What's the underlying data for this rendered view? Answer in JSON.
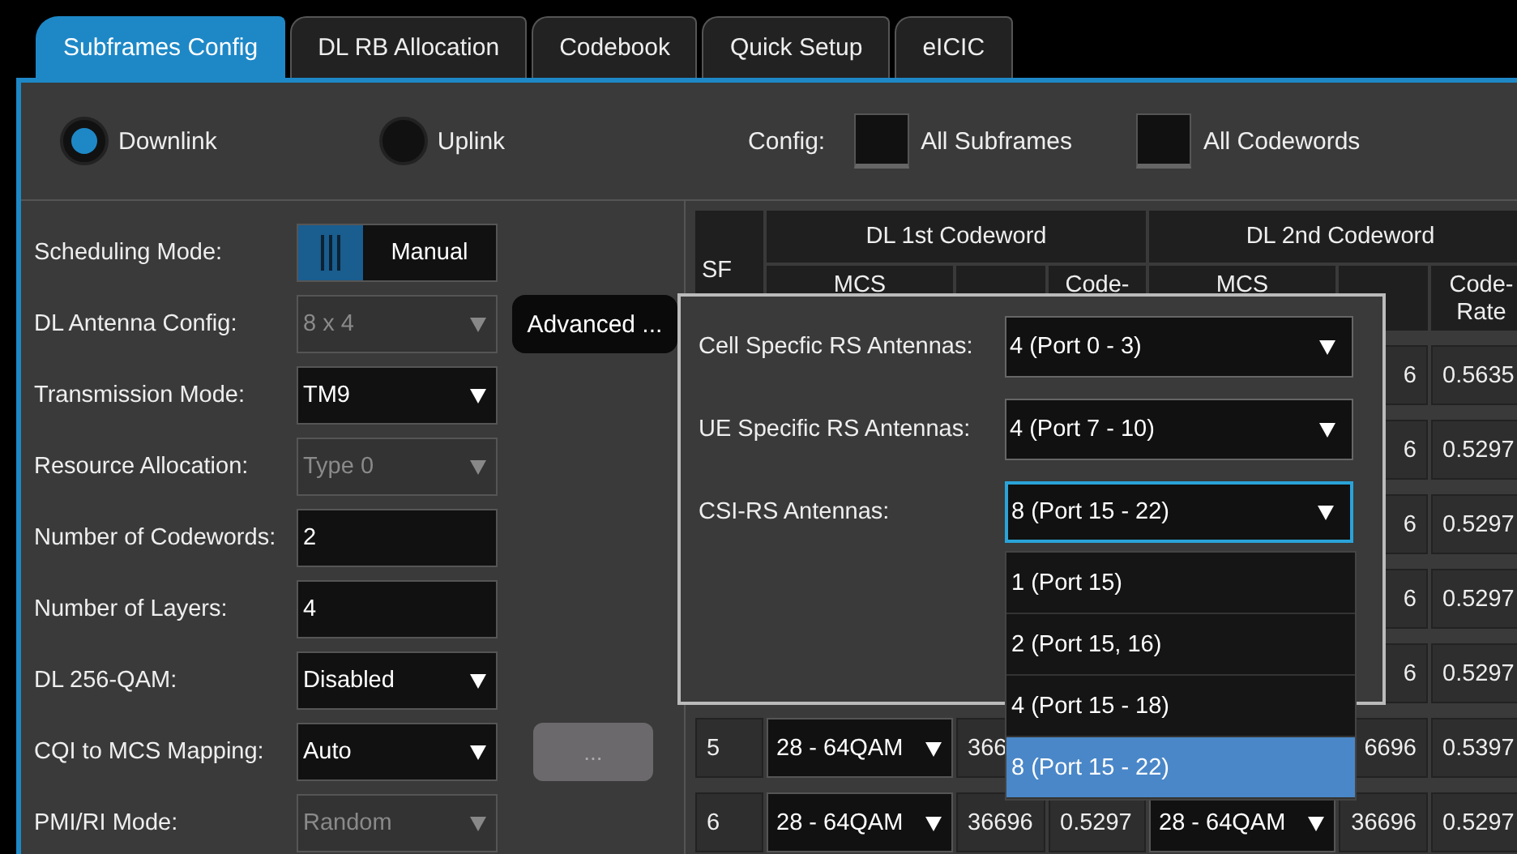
{
  "tabs": [
    {
      "label": "Subframes Config",
      "selected": true
    },
    {
      "label": "DL RB Allocation",
      "selected": false
    },
    {
      "label": "Codebook",
      "selected": false
    },
    {
      "label": "Quick Setup",
      "selected": false
    },
    {
      "label": "eICIC",
      "selected": false
    }
  ],
  "direction": [
    {
      "label": "Downlink",
      "selected": true
    },
    {
      "label": "Uplink",
      "selected": false
    }
  ],
  "config": {
    "label": "Config:",
    "options": [
      {
        "label": "All Subframes",
        "checked": false
      },
      {
        "label": "All Codewords",
        "checked": false
      }
    ]
  },
  "settings": [
    {
      "label": "Scheduling Mode:",
      "kind": "toggle",
      "value": "Manual",
      "disabled": false
    },
    {
      "label": "DL Antenna Config:",
      "kind": "select",
      "value": "8 x 4",
      "disabled": true
    },
    {
      "label": "Transmission Mode:",
      "kind": "select",
      "value": "TM9",
      "disabled": false
    },
    {
      "label": "Resource Allocation:",
      "kind": "select",
      "value": "Type 0",
      "disabled": true
    },
    {
      "label": "Number of Codewords:",
      "kind": "text",
      "value": "2",
      "disabled": false
    },
    {
      "label": "Number of Layers:",
      "kind": "text",
      "value": "4",
      "disabled": false
    },
    {
      "label": "DL 256-QAM:",
      "kind": "select",
      "value": "Disabled",
      "disabled": false
    },
    {
      "label": "CQI to MCS Mapping:",
      "kind": "select",
      "value": "Auto",
      "disabled": false
    },
    {
      "label": "PMI/RI Mode:",
      "kind": "select",
      "value": "Random",
      "disabled": true
    }
  ],
  "advanced_button": {
    "label": "Advanced ...",
    "disabled": false
  },
  "mapping_button": {
    "label": "...",
    "disabled": true
  },
  "table": {
    "sf": "SF",
    "groups": [
      {
        "title": "DL 1st Codeword",
        "mcs": "MCS",
        "code_rate": "Code-"
      },
      {
        "title": "DL 2nd Codeword",
        "mcs": "MCS",
        "code_rate": "Code-Rate"
      }
    ],
    "rows": [
      {
        "tbs_2": "6",
        "code_rate_2": "0.5635"
      },
      {
        "tbs_2": "6",
        "code_rate_2": "0.5297"
      },
      {
        "tbs_2": "6",
        "code_rate_2": "0.5297"
      },
      {
        "tbs_2": "6",
        "code_rate_2": "0.5297"
      },
      {
        "tbs_2": "6",
        "code_rate_2": "0.5297"
      },
      {
        "sf": "5",
        "mcs_1": "28 - 64QAM",
        "tbs_1": "366",
        "tbs_2": "6696",
        "code_rate_2": "0.5397"
      },
      {
        "sf": "6",
        "mcs_1": "28 - 64QAM",
        "tbs_1": "36696",
        "code_rate_1": "0.5297",
        "mcs_2": "28 - 64QAM",
        "tbs_2": "36696",
        "code_rate_2": "0.5297"
      }
    ]
  },
  "antenna_dialog": {
    "fields": [
      {
        "label": "Cell Specfic RS Antennas:",
        "value": "4 (Port 0 - 3)",
        "focused": false
      },
      {
        "label": "UE Specific RS Antennas:",
        "value": "4 (Port 7 - 10)",
        "focused": false
      },
      {
        "label": "CSI-RS Antennas:",
        "value": "8 (Port 15 - 22)",
        "focused": true
      }
    ],
    "options": [
      {
        "label": "1 (Port 15)",
        "selected": false
      },
      {
        "label": "2 (Port 15, 16)",
        "selected": false
      },
      {
        "label": "4 (Port 15 - 18)",
        "selected": false
      },
      {
        "label": "8 (Port 15 - 22)",
        "selected": true
      }
    ]
  }
}
